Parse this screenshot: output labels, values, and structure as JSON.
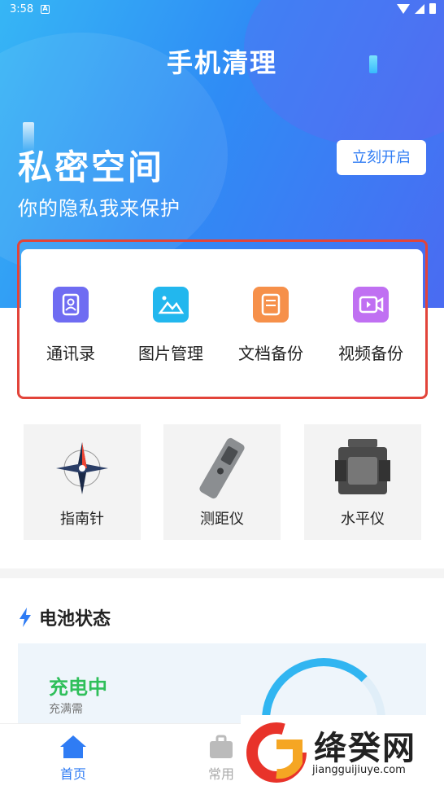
{
  "status": {
    "time": "3:58",
    "a_badge": "A"
  },
  "header": {
    "title": "手机清理"
  },
  "private_space": {
    "title": "私密空间",
    "subtitle": "你的隐私我来保护",
    "button": "立刻开启"
  },
  "quick_actions": [
    {
      "label": "通讯录",
      "icon": "contacts-icon",
      "color": "#6f6cf2"
    },
    {
      "label": "图片管理",
      "icon": "image-icon",
      "color": "#22b7ee"
    },
    {
      "label": "文档备份",
      "icon": "document-icon",
      "color": "#f6904a"
    },
    {
      "label": "视频备份",
      "icon": "video-icon",
      "color": "#c070f2"
    }
  ],
  "tools": [
    {
      "label": "指南针",
      "icon": "compass-icon"
    },
    {
      "label": "测距仪",
      "icon": "rangefinder-icon"
    },
    {
      "label": "水平仪",
      "icon": "level-icon"
    }
  ],
  "battery": {
    "header": "电池状态",
    "status": "充电中",
    "note": "充满需"
  },
  "nav": [
    {
      "label": "首页",
      "icon": "home-icon",
      "active": true
    },
    {
      "label": "常用",
      "icon": "briefcase-icon",
      "active": false
    }
  ],
  "watermark": {
    "brand": "绛癸网",
    "url": "jiangguijiuye.com"
  },
  "colors": {
    "accent": "#2f7cf4",
    "charging": "#2fbf5a",
    "highlight_frame": "#e2443a"
  }
}
